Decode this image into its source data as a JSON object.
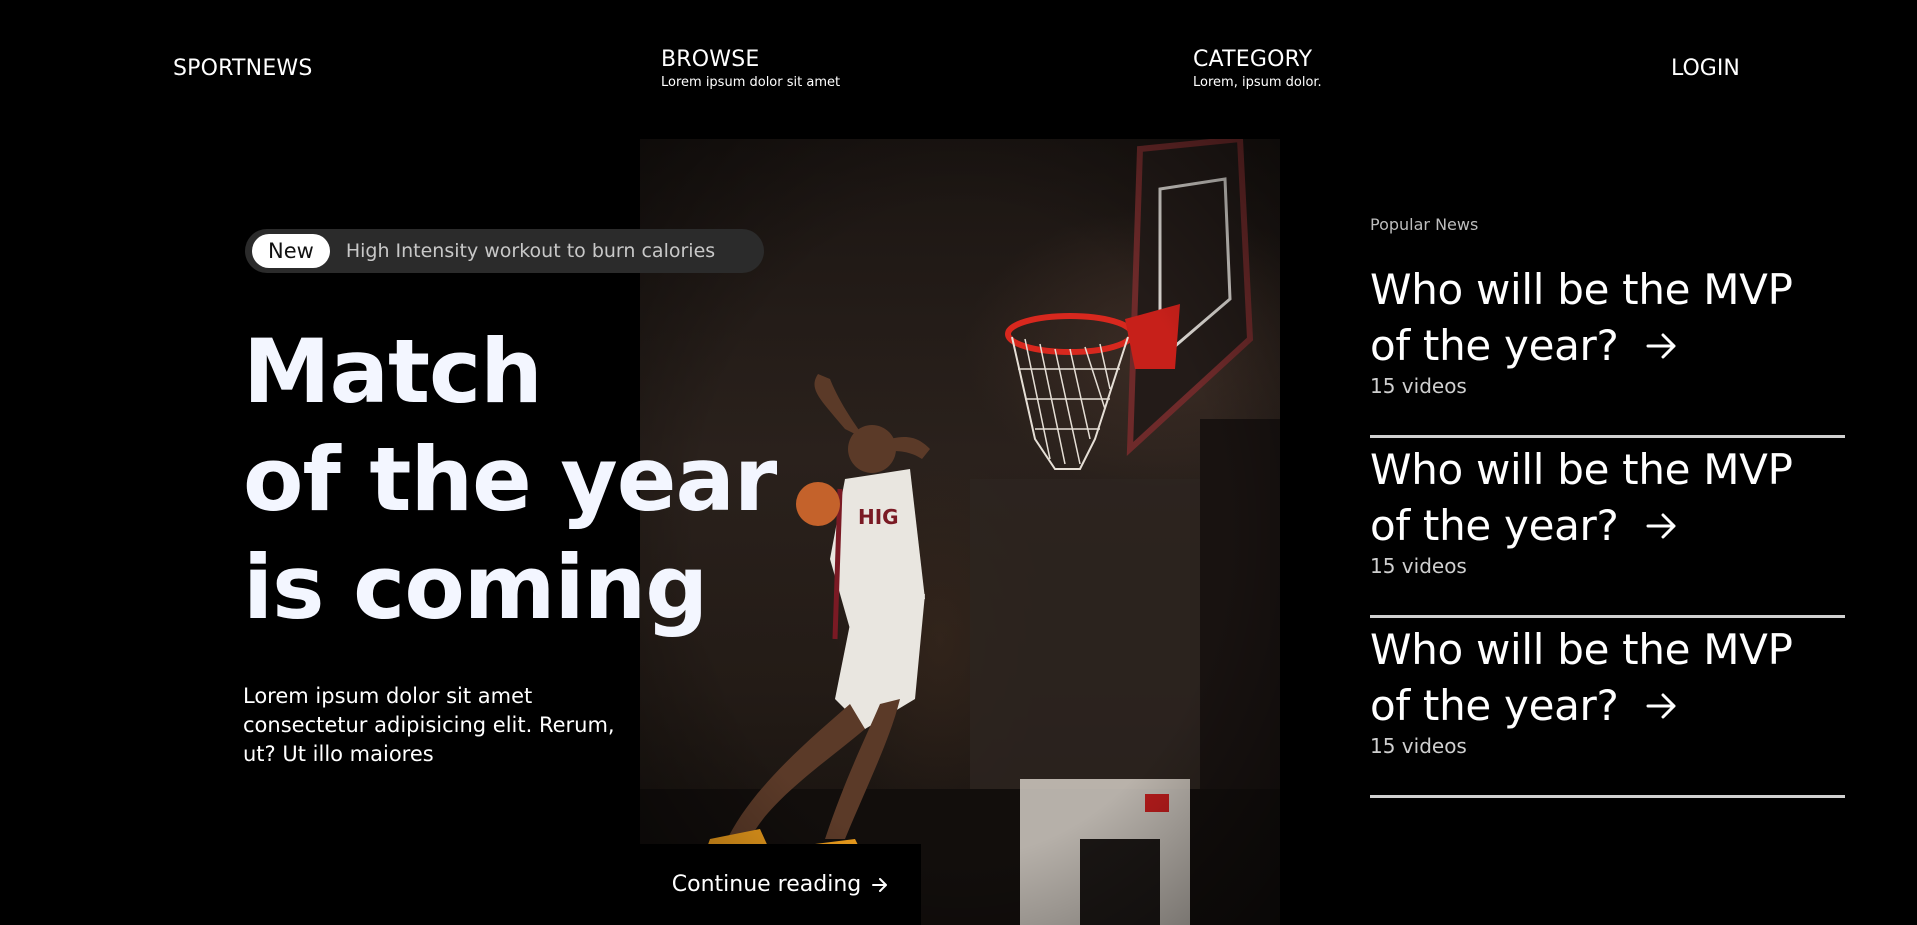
{
  "header": {
    "logo": "SPORTNEWS",
    "browse": {
      "title": "BROWSE",
      "subtitle": "Lorem ipsum dolor sit amet"
    },
    "category": {
      "title": "CATEGORY",
      "subtitle": "Lorem, ipsum dolor."
    },
    "login": "LOGIN"
  },
  "hero": {
    "tag_badge": "New",
    "tag_text": "High Intensity workout to burn calories",
    "headline": [
      "Match",
      "of the year",
      "is coming"
    ],
    "lead": "Lorem ipsum dolor sit amet consectetur adipisicing elit. Rerum, ut? Ut illo maiores",
    "cta_label": "Continue reading",
    "cta_icon": "arrow-right-icon",
    "image": "basketball-player-dunking-photo"
  },
  "popular": {
    "label": "Popular News",
    "items": [
      {
        "title": "Who will be the MVP of the year?",
        "count": "15 videos"
      },
      {
        "title": "Who will be the MVP of the year?",
        "count": "15 videos"
      },
      {
        "title": "Who will be the MVP of the year?",
        "count": "15 videos"
      }
    ]
  },
  "colors": {
    "background": "#000000",
    "headline": "#f3f6ff",
    "pill": "#2b2b2b",
    "rim": "#d8281e",
    "jersey": "#e9e6e0",
    "shoes": "#e89a1c"
  }
}
